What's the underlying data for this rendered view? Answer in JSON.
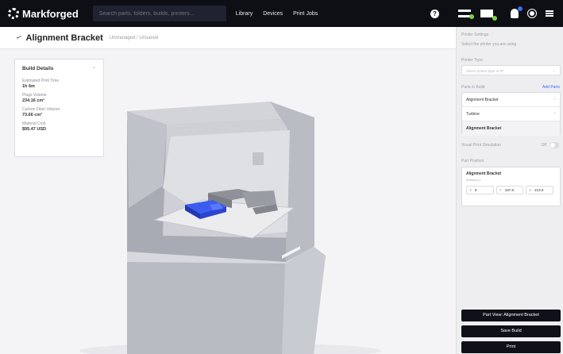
{
  "app": {
    "logo_text": "Markforged",
    "search_placeholder": "Search parts, folders, builds, printers...",
    "nav": [
      "Library",
      "Devices",
      "Print Jobs"
    ]
  },
  "header": {
    "title": "Alignment Bracket",
    "subtitle": "Unmanaged / Unsaved"
  },
  "build_details": {
    "heading": "Build Details",
    "rows": [
      {
        "label": "Estimated Print Time",
        "value": "1h 6m"
      },
      {
        "label": "Plugs Volume",
        "value": "234.16 cm³"
      },
      {
        "label": "Carbon Fiber Volume",
        "value": "73.66 cm³"
      },
      {
        "label": "Material Cost",
        "value": "$95.47 USD"
      }
    ]
  },
  "panel": {
    "printer_settings_label": "Printer Settings",
    "printer_settings_hint": "Select the printer you are using",
    "printer_type_label": "Printer Type",
    "printer_type_value": "Select printer type or IP",
    "parts_label": "Parts in Build",
    "parts_link": "Add Parts",
    "parts": [
      "Alignment Bracket",
      "Turbine",
      "Alignment Bracket"
    ],
    "toggle_label": "Visual Print Simulation",
    "toggle_state": "Off",
    "position_label": "Part Position",
    "position_part": "Alignment Bracket",
    "position_count": "Instance 1",
    "x_label": "X",
    "x_value": "8",
    "y_label": "Y",
    "y_value": "187.8",
    "z_label": "Z",
    "z_value": "213.6"
  },
  "actions": {
    "part_view": "Part View: Alignment Bracket",
    "save": "Save Build",
    "print": "Print"
  },
  "colors": {
    "topbar": "#0d0f15",
    "accent": "#3b6cff",
    "part_blue": "#2f4fe0",
    "status_green": "#7fd14a"
  }
}
